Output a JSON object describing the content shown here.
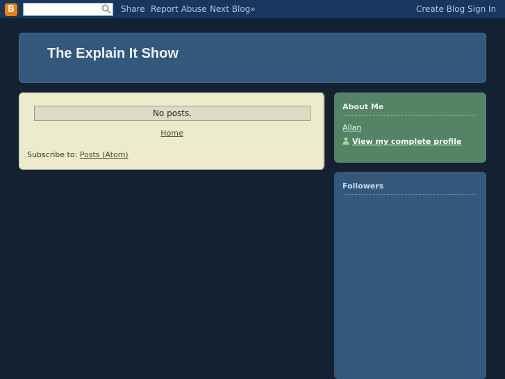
{
  "navbar": {
    "logo_letter": "B",
    "search_value": "",
    "links": {
      "share": "Share",
      "report_abuse": "Report Abuse",
      "next_blog": "Next Blog»",
      "create_blog": "Create Blog",
      "sign_in": "Sign In"
    }
  },
  "header": {
    "title": "The Explain It Show"
  },
  "main": {
    "no_posts": "No posts.",
    "home_link": "Home",
    "subscribe_label": "Subscribe to:",
    "subscribe_link": "Posts (Atom)"
  },
  "sidebar": {
    "about": {
      "title": "About Me",
      "name": "Allan",
      "profile_link": "View my complete profile"
    },
    "followers": {
      "title": "Followers"
    }
  },
  "colors": {
    "page_bg": "#142132",
    "navbar_bg": "#19375e",
    "header_bg": "#34587c",
    "main_bg": "#ececcc",
    "about_bg": "#538466",
    "followers_bg": "#34587c",
    "logo_orange": "#f57d00"
  }
}
